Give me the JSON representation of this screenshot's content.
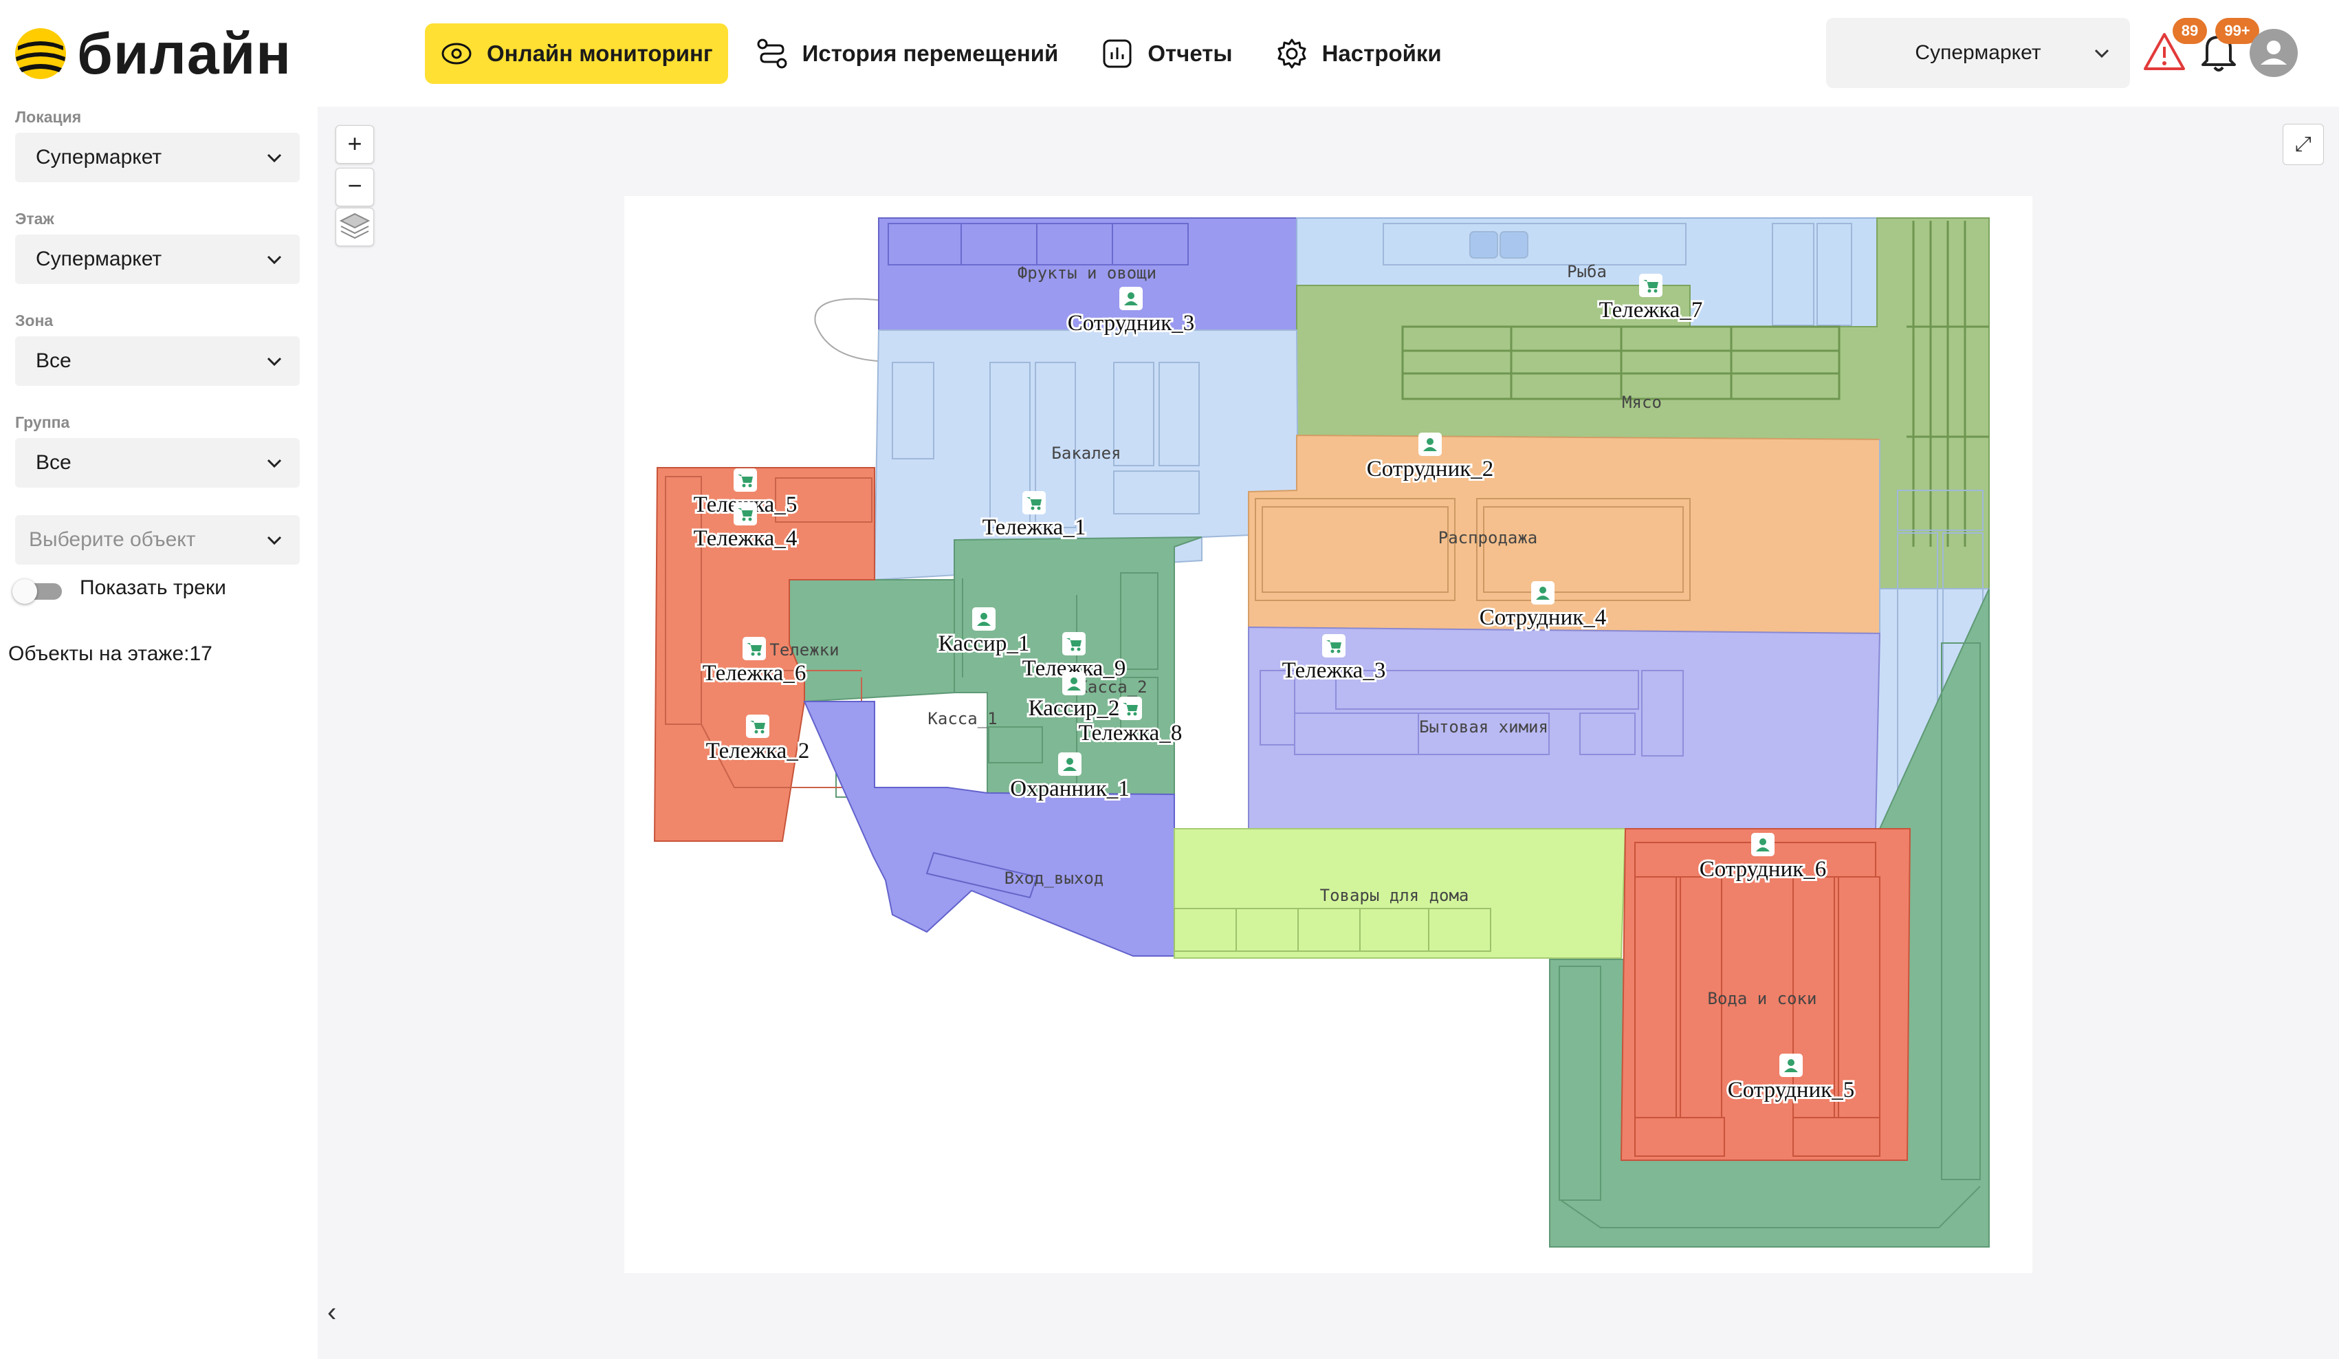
{
  "brand": {
    "name": "билайн",
    "colors": {
      "yellow": "#ffe033",
      "black": "#1b1b1b"
    }
  },
  "nav": [
    {
      "label": "Онлайн мониторинг",
      "icon": "eye-icon",
      "active": true
    },
    {
      "label": "История перемещений",
      "icon": "route-icon",
      "active": false
    },
    {
      "label": "Отчеты",
      "icon": "report-icon",
      "active": false
    },
    {
      "label": "Настройки",
      "icon": "gear-icon",
      "active": false
    }
  ],
  "header": {
    "location_select": "Супермаркет",
    "alerts_badge": "89",
    "notifications_badge": "99+"
  },
  "sidebar": {
    "location": {
      "label": "Локация",
      "value": "Супермаркет"
    },
    "floor": {
      "label": "Этаж",
      "value": "Супермаркет"
    },
    "zone": {
      "label": "Зона",
      "value": "Все"
    },
    "group": {
      "label": "Группа",
      "value": "Все"
    },
    "object_select": {
      "placeholder": "Выберите объект"
    },
    "show_tracks": "Показать треки",
    "objects_on_floor": "Объекты на этаже:17"
  },
  "map": {
    "zoom_in": "+",
    "zoom_out": "−",
    "zones": [
      {
        "name": "Фрукты и овощи",
        "color": "#9a9af0"
      },
      {
        "name": "Рыба",
        "color": "#c5dcf7"
      },
      {
        "name": "Мясо",
        "color": "#a6c787"
      },
      {
        "name": "Бакалея",
        "color": "#c9ddf7"
      },
      {
        "name": "Распродажа",
        "color": "#f5c08d"
      },
      {
        "name": "Тележки",
        "color": "#f0876a"
      },
      {
        "name": "Касса_1",
        "color": "#7fb894"
      },
      {
        "name": "Касса_2",
        "color": "#7fb894"
      },
      {
        "name": "Бытовая химия",
        "color": "#b9b9f3"
      },
      {
        "name": "Вход_выход",
        "color": "#9c9cf0"
      },
      {
        "name": "Товары для дома",
        "color": "#d2f59c"
      },
      {
        "name": "Вода и соки",
        "color": "#ef8069"
      }
    ],
    "objects": [
      {
        "label": "Сотрудник_3",
        "kind": "person-icon"
      },
      {
        "label": "Тележка_7",
        "kind": "cart-icon"
      },
      {
        "label": "Сотрудник_2",
        "kind": "person-icon"
      },
      {
        "label": "Тележка_5",
        "kind": "cart-icon"
      },
      {
        "label": "Тележка_4",
        "kind": "cart-icon"
      },
      {
        "label": "Тележка_1",
        "kind": "cart-icon"
      },
      {
        "label": "Сотрудник_4",
        "kind": "person-icon"
      },
      {
        "label": "Кассир_1",
        "kind": "person-icon"
      },
      {
        "label": "Тележка_6",
        "kind": "cart-icon"
      },
      {
        "label": "Тележка_9",
        "kind": "cart-icon"
      },
      {
        "label": "Тележка_3",
        "kind": "cart-icon"
      },
      {
        "label": "Кассир_2",
        "kind": "person-icon"
      },
      {
        "label": "Тележка_8",
        "kind": "cart-icon"
      },
      {
        "label": "Тележка_2",
        "kind": "cart-icon"
      },
      {
        "label": "Охранник_1",
        "kind": "person-icon"
      },
      {
        "label": "Сотрудник_6",
        "kind": "person-icon"
      },
      {
        "label": "Сотрудник_5",
        "kind": "person-icon"
      }
    ]
  }
}
